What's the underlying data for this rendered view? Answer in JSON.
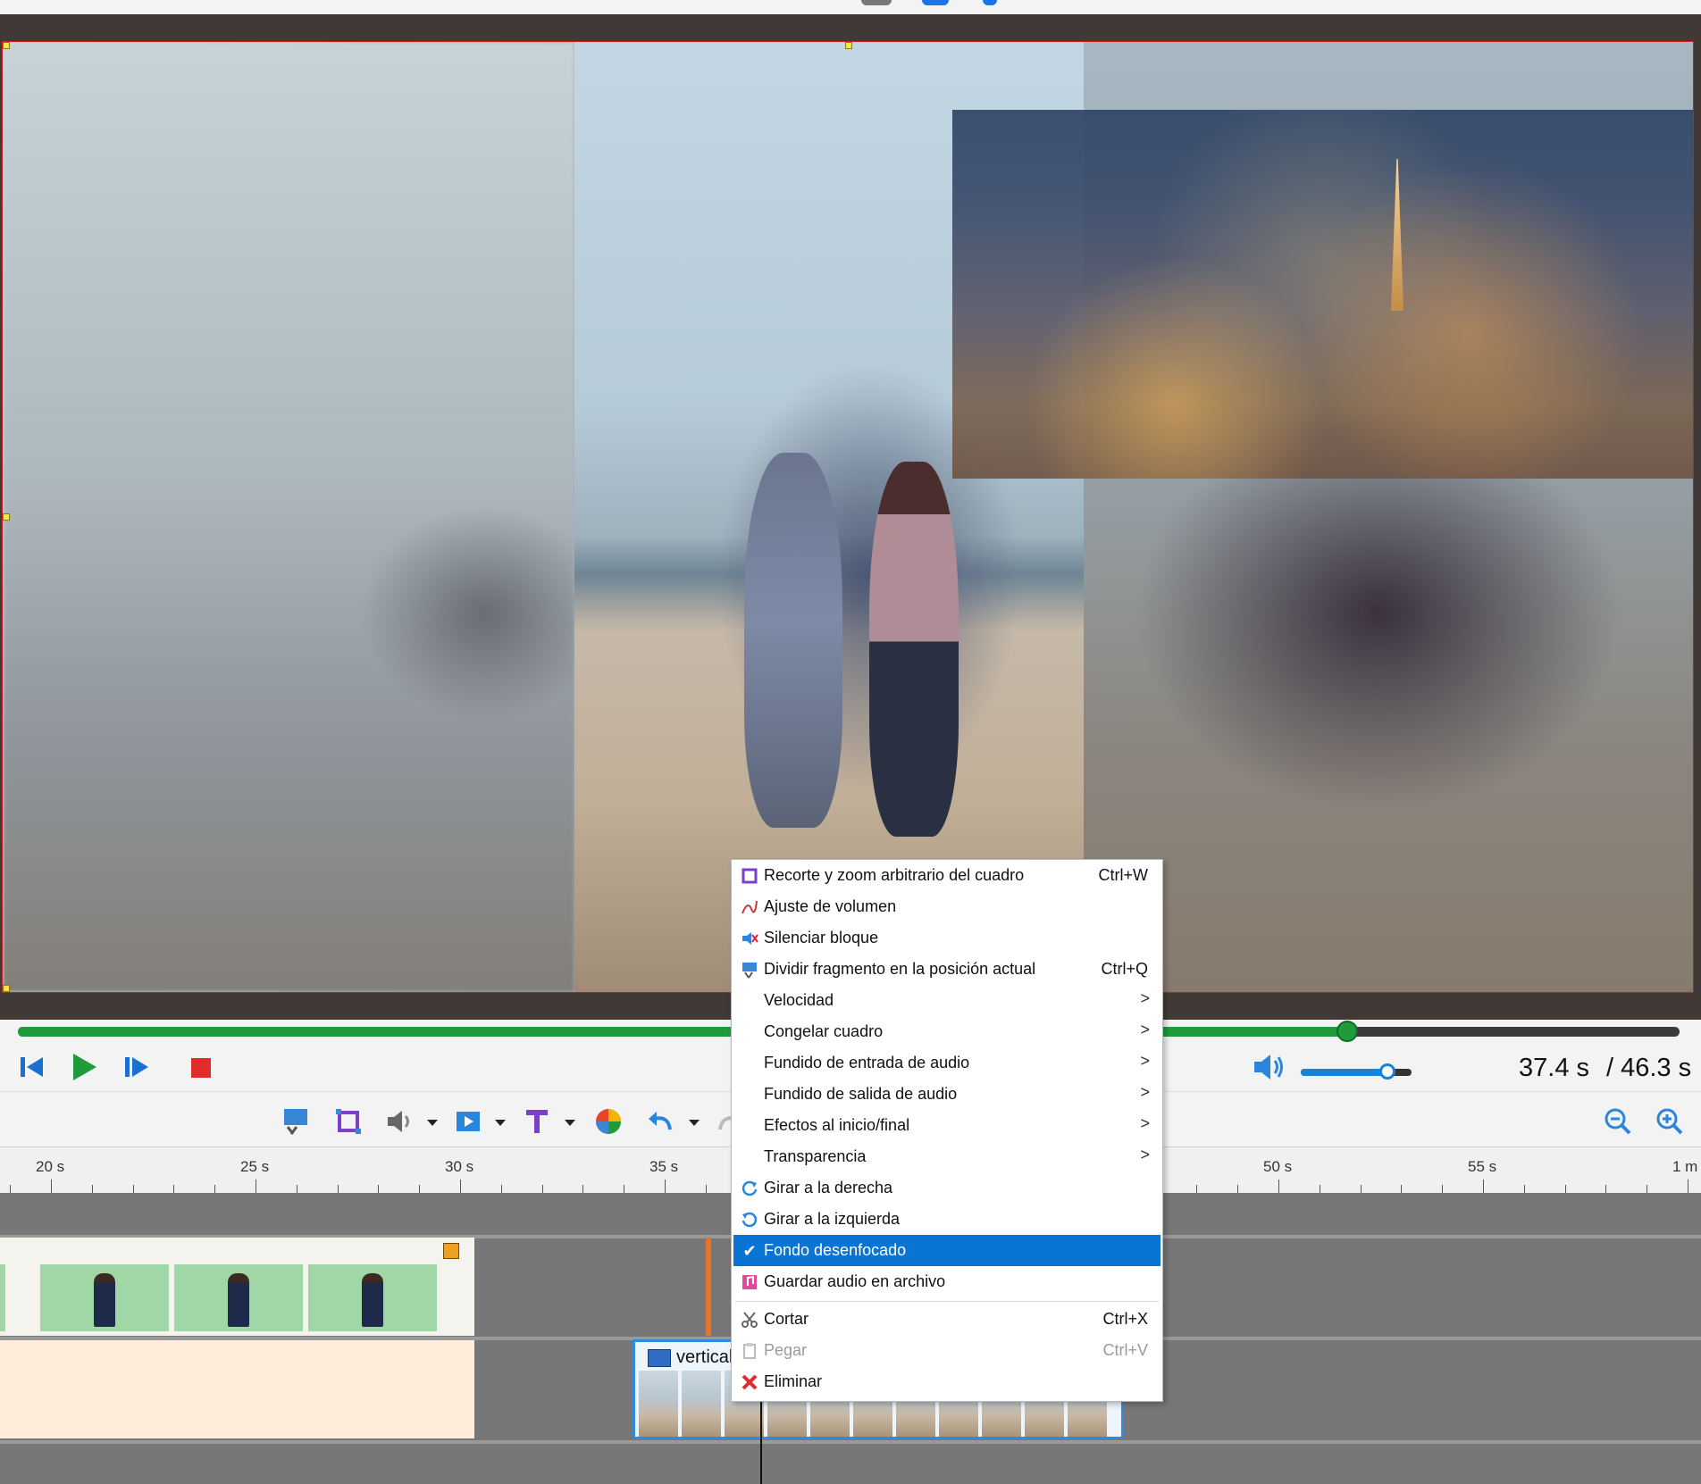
{
  "preview": {},
  "transport": {
    "seek_progress": 0.8,
    "current_time": "37.4 s",
    "total_time": "/ 46.3 s",
    "volume_level": 0.8
  },
  "toolbar": {
    "icons": [
      "select-clip-icon",
      "crop-icon",
      "volume-icon",
      "video-effects-icon",
      "text-icon",
      "color-icon",
      "undo-icon",
      "redo-icon",
      "zoom-out-icon",
      "zoom-in-icon"
    ]
  },
  "ruler": {
    "ticks": [
      "20 s",
      "25 s",
      "30 s",
      "35 s",
      "50 s",
      "55 s",
      "1 m"
    ]
  },
  "timeline": {
    "video_clip_label": "vertical"
  },
  "context_menu": {
    "items": [
      {
        "label": "Recorte y zoom arbitrario del cuadro",
        "shortcut": "Ctrl+W",
        "icon": "crop-icon"
      },
      {
        "label": "Ajuste de volumen",
        "shortcut": "",
        "icon": "volume-curve-icon"
      },
      {
        "label": "Silenciar bloque",
        "shortcut": "",
        "icon": "mute-icon"
      },
      {
        "label": "Dividir fragmento en la posición actual",
        "shortcut": "Ctrl+Q",
        "icon": "split-icon"
      },
      {
        "label": "Velocidad",
        "submenu": ">"
      },
      {
        "label": "Congelar cuadro",
        "submenu": ">"
      },
      {
        "label": "Fundido de entrada de audio",
        "submenu": ">"
      },
      {
        "label": "Fundido de salida de audio",
        "submenu": ">"
      },
      {
        "label": "Efectos al inicio/final",
        "submenu": ">"
      },
      {
        "label": "Transparencia",
        "submenu": ">"
      },
      {
        "label": "Girar a la derecha",
        "icon": "rotate-right-icon"
      },
      {
        "label": "Girar a la izquierda",
        "icon": "rotate-left-icon"
      },
      {
        "label": "Fondo desenfocado",
        "icon": "check-icon",
        "checked": true
      },
      {
        "label": "Guardar audio en archivo",
        "icon": "save-audio-icon"
      },
      {
        "label": "Cortar",
        "shortcut": "Ctrl+X",
        "icon": "scissors-icon"
      },
      {
        "label": "Pegar",
        "shortcut": "Ctrl+V",
        "icon": "paste-icon",
        "disabled": true
      },
      {
        "label": "Eliminar",
        "icon": "delete-icon"
      }
    ],
    "check_glyph": "✔",
    "selected_color": "#0a74d4"
  }
}
